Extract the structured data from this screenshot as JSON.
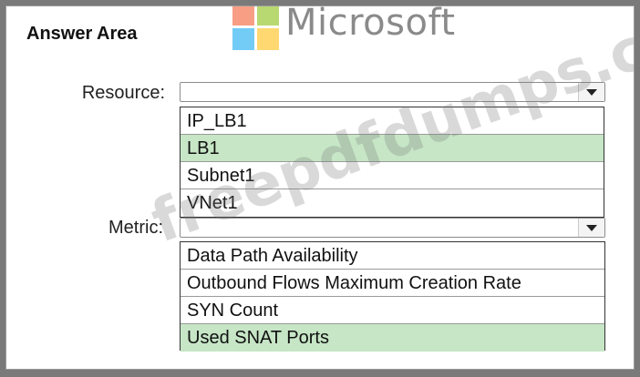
{
  "answer_area": {
    "title": "Answer Area"
  },
  "logo": {
    "text": "Microsoft"
  },
  "watermark": {
    "text": "freepdfdumps.com"
  },
  "resource": {
    "label": "Resource:",
    "options": [
      {
        "label": "IP_LB1",
        "selected": false
      },
      {
        "label": "LB1",
        "selected": true
      },
      {
        "label": "Subnet1",
        "selected": false
      },
      {
        "label": "VNet1",
        "selected": false
      }
    ]
  },
  "metric": {
    "label": "Metric:",
    "options": [
      {
        "label": "Data Path Availability",
        "selected": false
      },
      {
        "label": "Outbound Flows Maximum Creation Rate",
        "selected": false
      },
      {
        "label": "SYN Count",
        "selected": false
      },
      {
        "label": "Used SNAT Ports",
        "selected": true
      }
    ]
  },
  "colors": {
    "selected_highlight": "#c6e6c6",
    "frame": "#7a7a7a"
  }
}
